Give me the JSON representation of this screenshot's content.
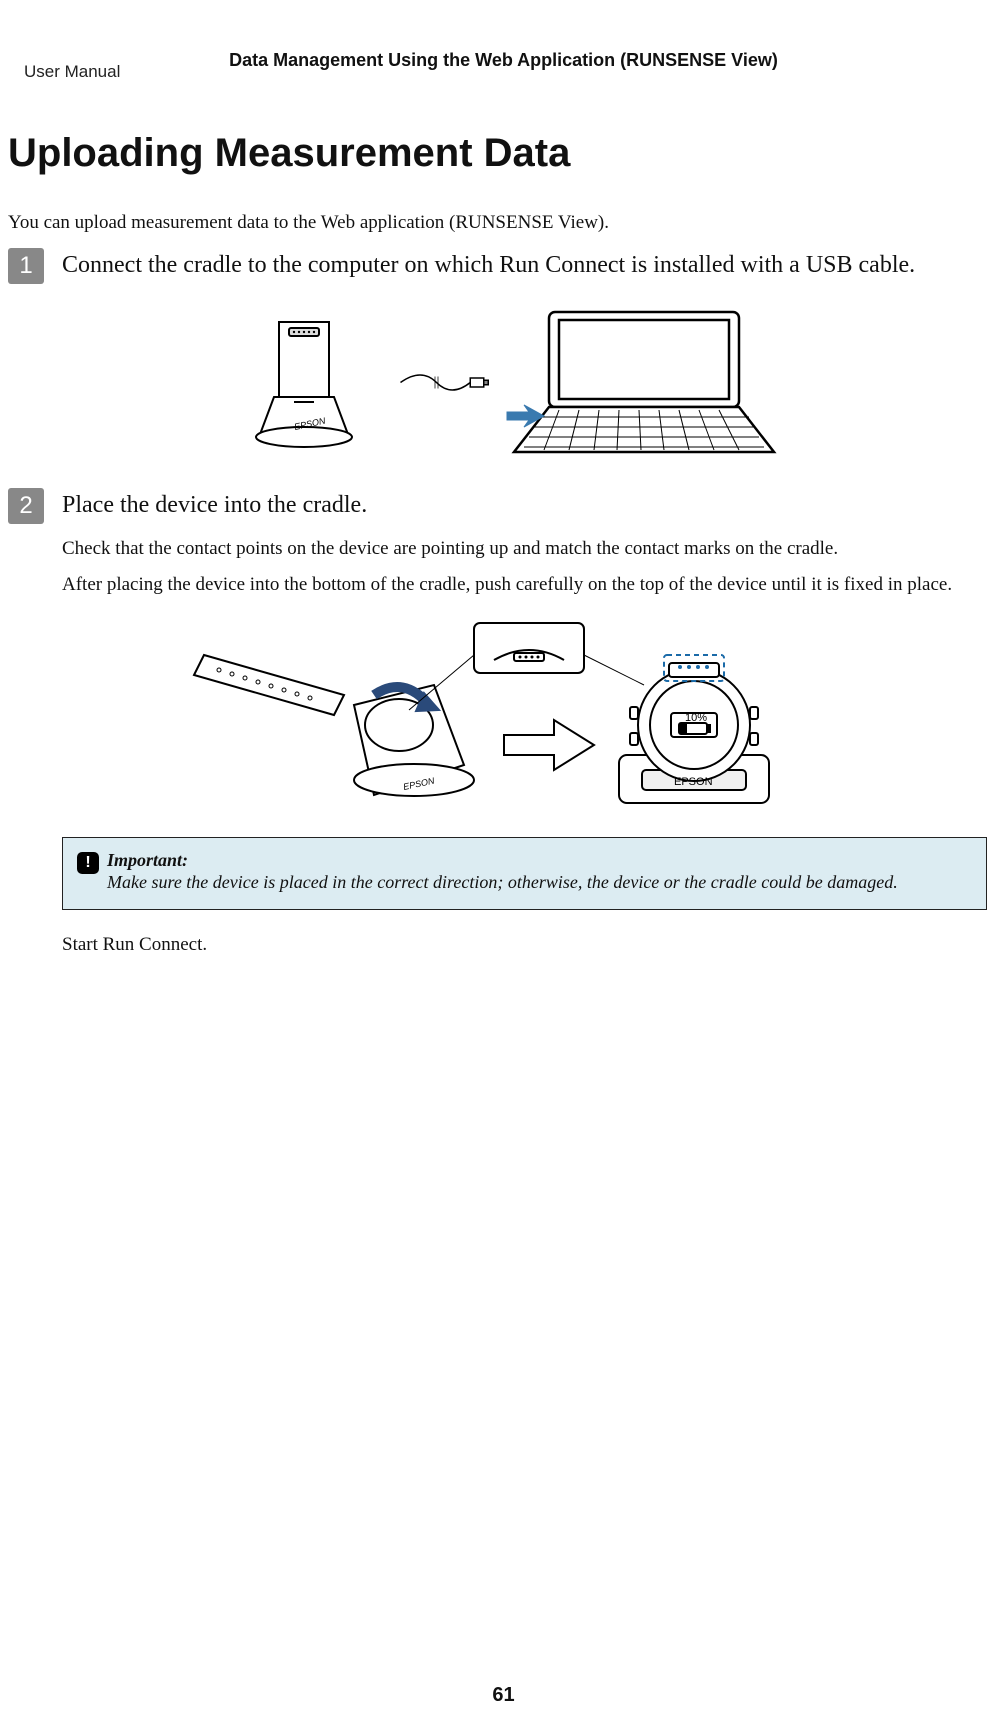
{
  "doc_type": "User Manual",
  "section_header": "Data Management Using the Web Application (RUNSENSE View)",
  "main_title": "Uploading Measurement Data",
  "intro": "You can upload measurement data to the Web application (RUNSENSE View).",
  "steps": [
    {
      "number": "1",
      "text": "Connect the cradle to the computer on which Run Connect is installed with a USB cable."
    },
    {
      "number": "2",
      "text": "Place the device into the cradle.",
      "body": [
        "Check that the contact points on the device are pointing up and match the contact marks on the cradle.",
        "After placing the device into the bottom of the cradle, push carefully on the top of the device until it is fixed in place."
      ]
    }
  ],
  "important": {
    "label": "Important:",
    "body": "Make sure the device is placed in the correct direction; otherwise, the device or the cradle could be damaged."
  },
  "after_important": "Start Run Connect.",
  "page_number": "61",
  "illustration_labels": {
    "brand_cradle": "EPSON",
    "brand_device": "EPSON",
    "battery_percent": "10%"
  }
}
